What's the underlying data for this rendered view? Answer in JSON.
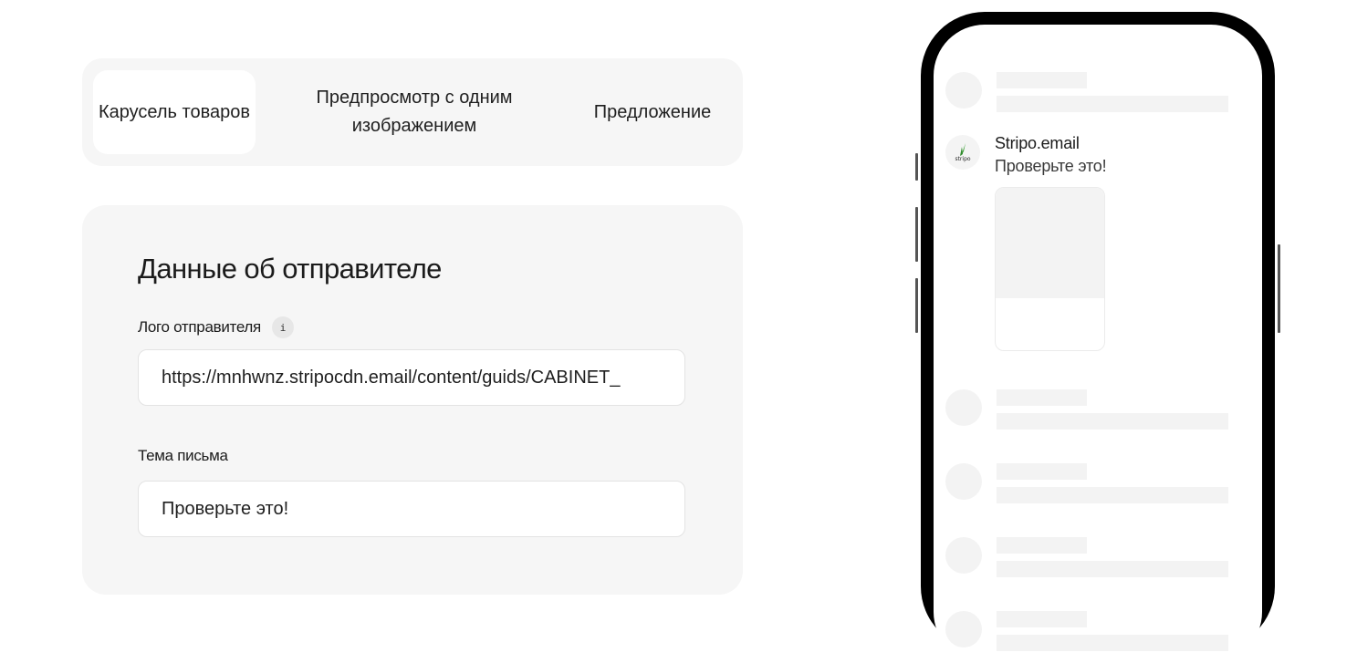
{
  "tabs": [
    {
      "label": "Карусель товаров",
      "active": true
    },
    {
      "label": "Предпросмотр с одним изображением",
      "active": false
    },
    {
      "label": "Предложение",
      "active": false
    }
  ],
  "form": {
    "title": "Данные об отправителе",
    "logo_label": "Лого отправителя",
    "info_icon": "info-icon",
    "info_glyph": "i",
    "logo_value": "https://mnhwnz.stripocdn.email/content/guids/CABINET_",
    "subject_label": "Тема письма",
    "subject_value": "Проверьте это!"
  },
  "phone": {
    "sender_name": "Stripo.email",
    "sender_subject": "Проверьте это!",
    "avatar_logo_text": "stripo",
    "colors": {
      "frame": "#000000",
      "skeleton": "#f3f3f3",
      "logo_green": "#3aa035"
    }
  }
}
